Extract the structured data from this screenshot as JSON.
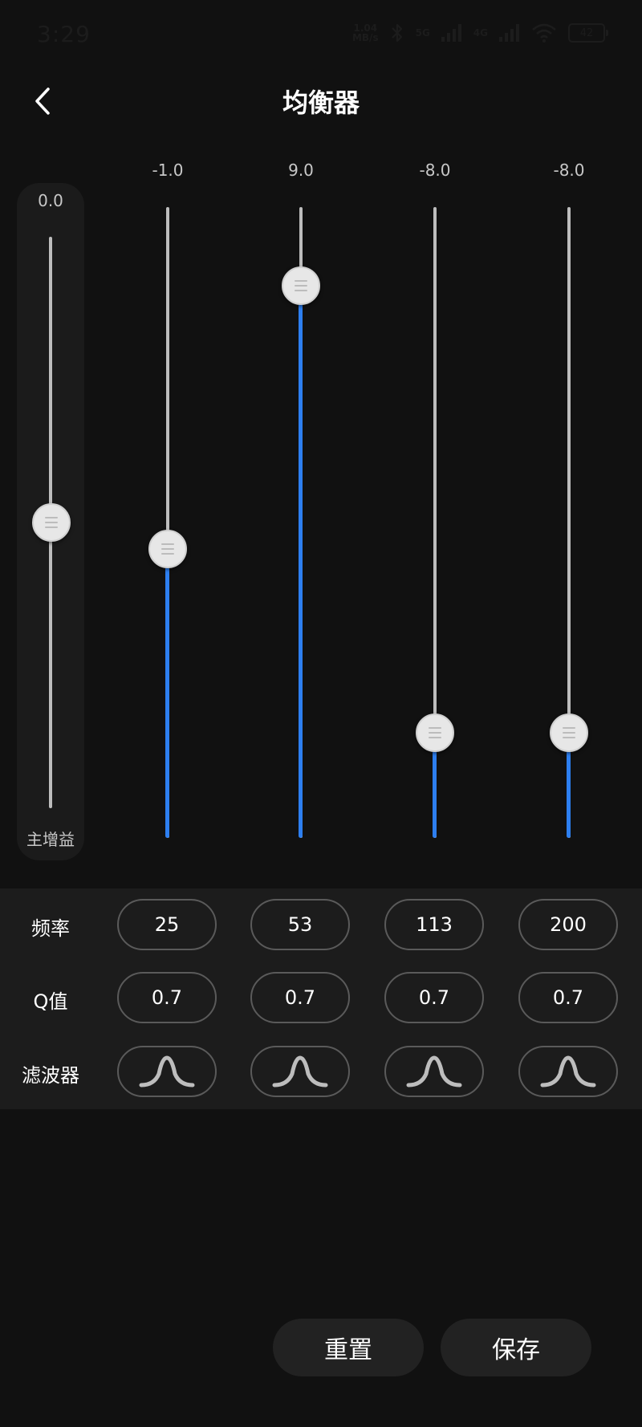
{
  "status_bar": {
    "time": "3:29",
    "net_speed_value": "1.04",
    "net_speed_unit": "MB/s",
    "signal_5g": "5G",
    "signal_4g": "4G",
    "battery": "42"
  },
  "header": {
    "title": "均衡器",
    "back_icon": "chevron-left-icon"
  },
  "master_gain": {
    "value": "0.0",
    "label": "主增益",
    "level": 0.5
  },
  "bands": [
    {
      "value": "-1.0",
      "gain": -1.0,
      "frequency": "25",
      "q": "0.7",
      "filter_icon": "peak-filter-icon"
    },
    {
      "value": "9.0",
      "gain": 9.0,
      "frequency": "53",
      "q": "0.7",
      "filter_icon": "peak-filter-icon"
    },
    {
      "value": "-8.0",
      "gain": -8.0,
      "frequency": "113",
      "q": "0.7",
      "filter_icon": "peak-filter-icon"
    },
    {
      "value": "-8.0",
      "gain": -8.0,
      "frequency": "200",
      "q": "0.7",
      "filter_icon": "peak-filter-icon"
    }
  ],
  "gain_range": [
    -12,
    12
  ],
  "rows": {
    "frequency_label": "频率",
    "q_label": "Q值",
    "filter_label": "滤波器"
  },
  "buttons": {
    "reset": "重置",
    "save": "保存"
  },
  "colors": {
    "accent": "#2d7ff0",
    "background": "#111111",
    "panel": "#1c1c1c"
  }
}
